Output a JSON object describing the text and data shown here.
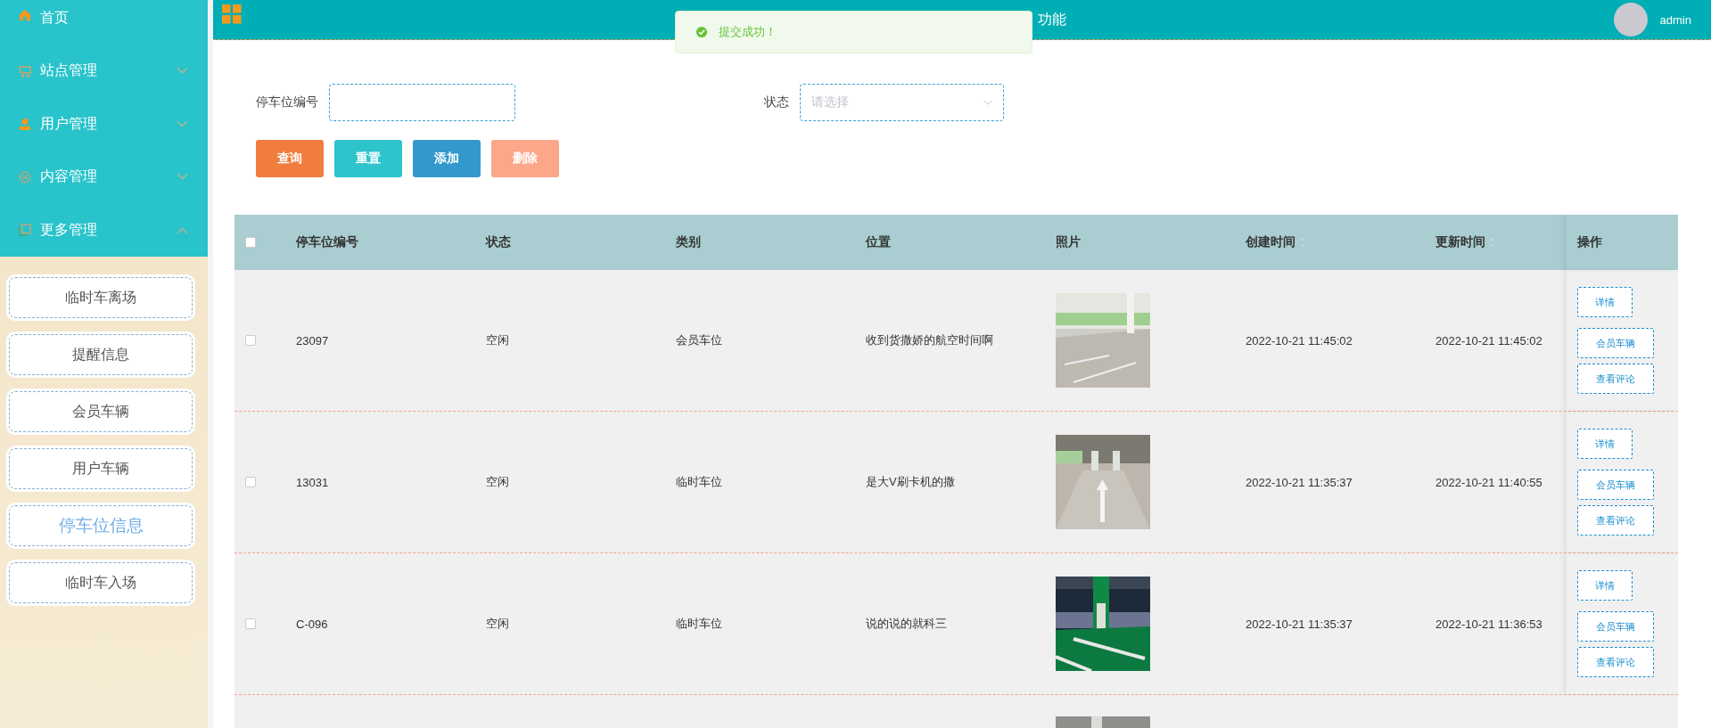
{
  "sidebar": {
    "menu": [
      {
        "label": "首页"
      },
      {
        "label": "站点管理",
        "expanded": false
      },
      {
        "label": "用户管理",
        "expanded": false
      },
      {
        "label": "内容管理",
        "expanded": false
      },
      {
        "label": "更多管理",
        "expanded": true,
        "children": [
          {
            "label": "临时车离场",
            "selected": false
          },
          {
            "label": "提醒信息",
            "selected": false
          },
          {
            "label": "会员车辆",
            "selected": false
          },
          {
            "label": "用户车辆",
            "selected": false
          },
          {
            "label": "停车位信息",
            "selected": true
          },
          {
            "label": "临时车入场",
            "selected": false
          }
        ]
      }
    ]
  },
  "header": {
    "title": "功能",
    "user": "admin"
  },
  "toast": {
    "message": "提交成功！"
  },
  "search": {
    "fields": [
      {
        "label": "停车位编号",
        "kind": "input"
      },
      {
        "label": "状态",
        "kind": "select",
        "placeholder": "请选择"
      }
    ],
    "buttons": [
      {
        "label": "查询",
        "color": "#f07c3e"
      },
      {
        "label": "重置",
        "color": "#2ec4cb"
      },
      {
        "label": "添加",
        "color": "#3399cc"
      },
      {
        "label": "删除",
        "color": "#fca68a"
      }
    ]
  },
  "table": {
    "all_checked": false,
    "columns": [
      {
        "label": "停车位编号",
        "sortable": false
      },
      {
        "label": "状态",
        "sortable": false
      },
      {
        "label": "类别",
        "sortable": false
      },
      {
        "label": "位置",
        "sortable": false
      },
      {
        "label": "照片",
        "sortable": false
      },
      {
        "label": "创建时间",
        "sortable": true
      },
      {
        "label": "更新时间",
        "sortable": true
      },
      {
        "label": "操作",
        "sortable": false
      }
    ],
    "rows": [
      {
        "checked": false,
        "cells": [
          "23097",
          "空闲",
          "会员车位",
          "收到货撒娇的航空时间啊"
        ],
        "created": "2022-10-21 11:45:02",
        "updated": "2022-10-21 11:45:02",
        "actions": [
          "详情",
          "会员车辆",
          "查看评论"
        ]
      },
      {
        "checked": false,
        "cells": [
          "13031",
          "空闲",
          "临时车位",
          "是大V刷卡机的撒"
        ],
        "created": "2022-10-21 11:35:37",
        "updated": "2022-10-21 11:40:55",
        "actions": [
          "详情",
          "会员车辆",
          "查看评论"
        ]
      },
      {
        "checked": false,
        "cells": [
          "C-096",
          "空闲",
          "临时车位",
          "说的说的就科三"
        ],
        "created": "2022-10-21 11:35:37",
        "updated": "2022-10-21 11:36:53",
        "actions": [
          "详情",
          "会员车辆",
          "查看评论"
        ]
      }
    ]
  }
}
